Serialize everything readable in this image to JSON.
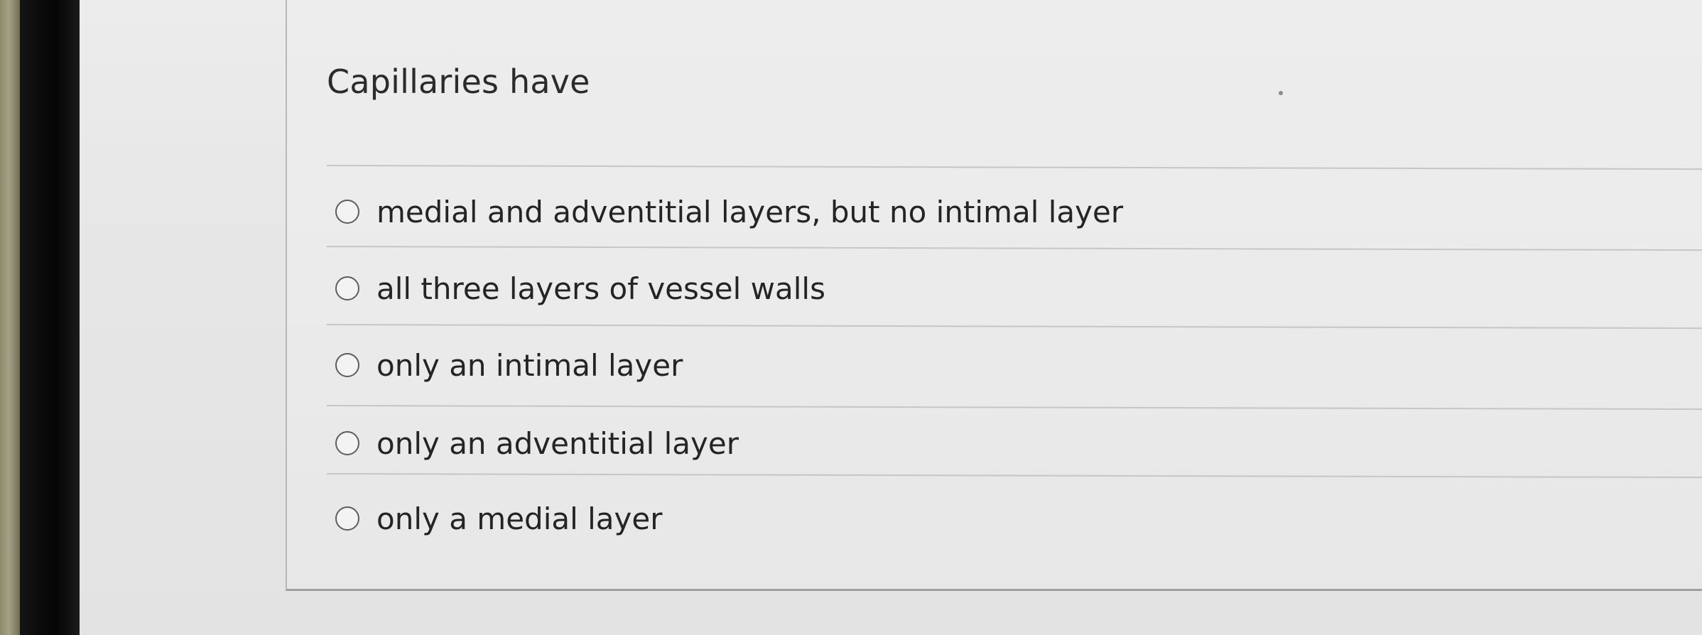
{
  "question": {
    "text": "Capillaries have"
  },
  "options": [
    {
      "label": "medial and adventitial layers, but no intimal layer",
      "selected": false
    },
    {
      "label": "all three layers of vessel walls",
      "selected": false
    },
    {
      "label": "only an intimal layer",
      "selected": false
    },
    {
      "label": "only an adventitial layer",
      "selected": false
    },
    {
      "label": "only a medial layer",
      "selected": false
    }
  ]
}
